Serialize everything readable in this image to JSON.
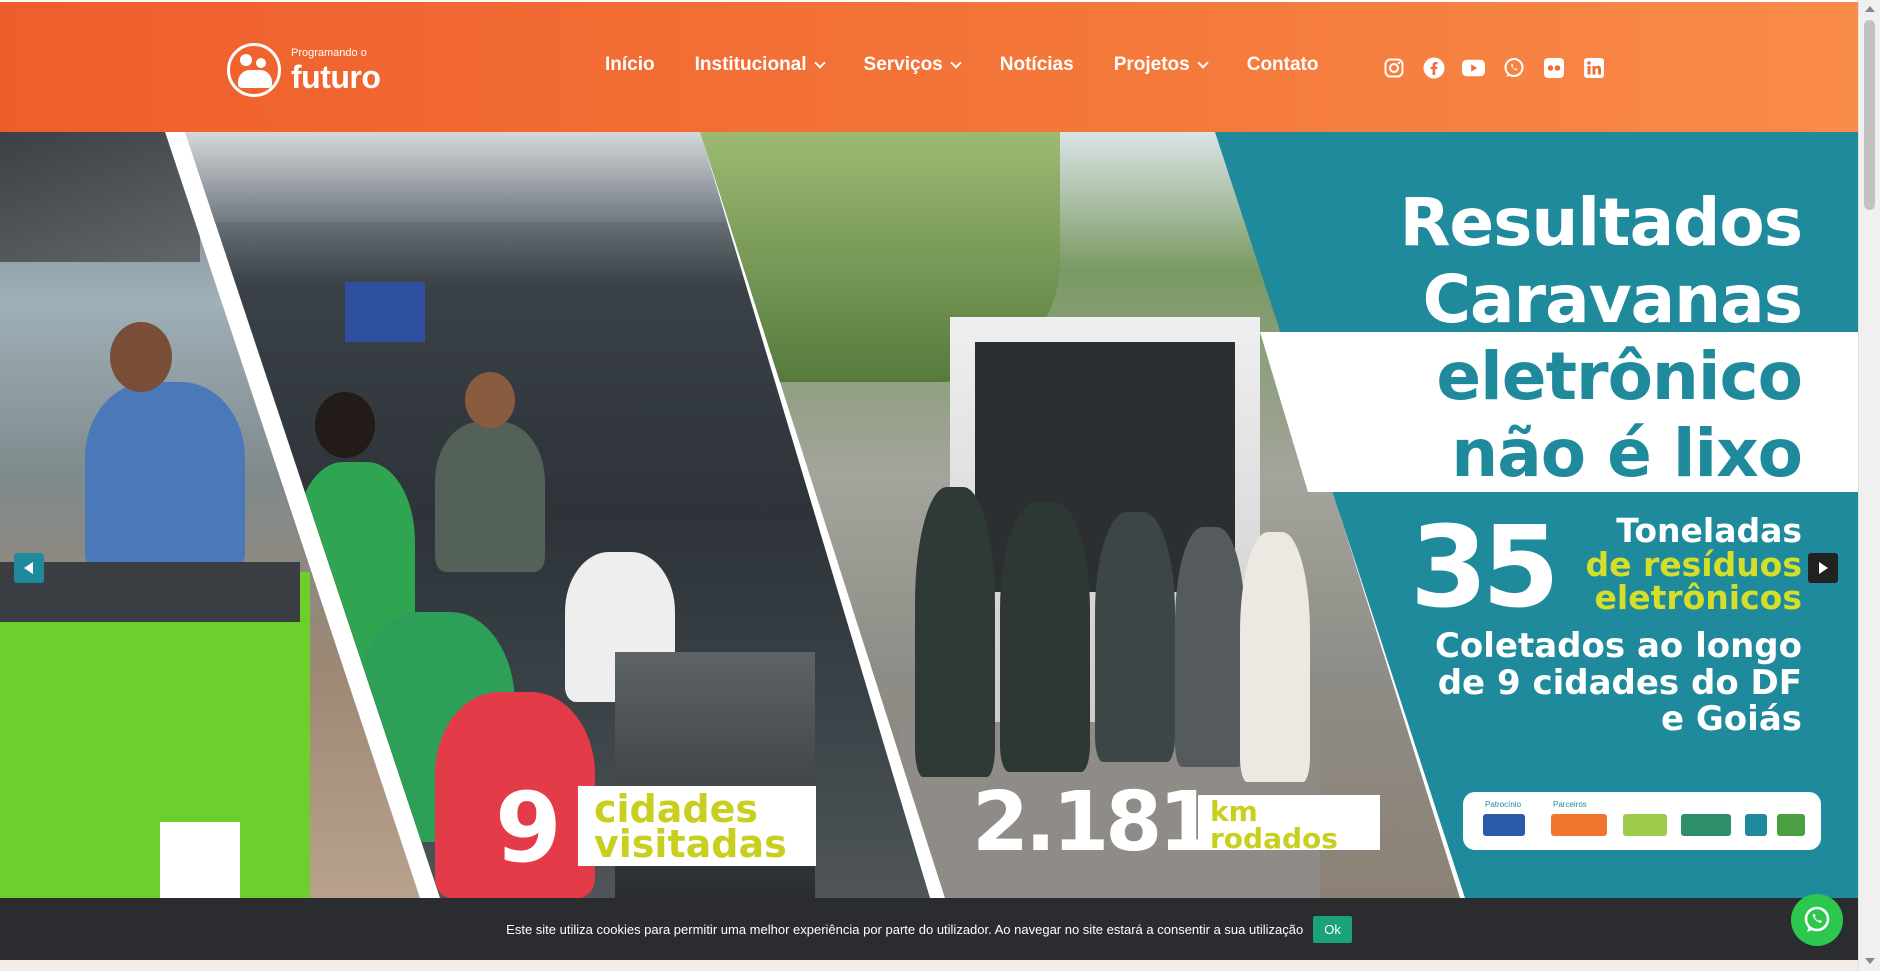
{
  "header": {
    "logo": {
      "small_text": "Programando o",
      "big_text": "futuro"
    },
    "nav": [
      {
        "label": "Início",
        "dropdown": false
      },
      {
        "label": "Institucional",
        "dropdown": true
      },
      {
        "label": "Serviços",
        "dropdown": true
      },
      {
        "label": "Notícias",
        "dropdown": false
      },
      {
        "label": "Projetos",
        "dropdown": true
      },
      {
        "label": "Contato",
        "dropdown": false
      }
    ],
    "social": [
      "instagram-icon",
      "facebook-icon",
      "youtube-icon",
      "whatsapp-icon",
      "flickr-icon",
      "linkedin-icon"
    ]
  },
  "hero": {
    "title_lines": [
      "Resultados",
      "Caravanas",
      "eletrônico",
      "não é lixo"
    ],
    "big_number": "35",
    "ton_line1": "Toneladas",
    "ton_line2": "de resíduos",
    "ton_line3": "eletrônicos",
    "coletados_lines": [
      "Coletados ao longo",
      "de 9 cidades do DF",
      "e Goiás"
    ],
    "stat_cities_number": "9",
    "stat_cities_line1": "cidades",
    "stat_cities_line2": "visitadas",
    "stat_km_number": "2.181",
    "stat_km_line1": "km",
    "stat_km_line2": "rodados",
    "sponsors": {
      "patrocinio_label": "Patrocínio",
      "parceiros_label": "Parceiros"
    },
    "colors": {
      "teal": "#1e8a9c",
      "lime": "#d5df29",
      "orange": "#ef5d2c"
    }
  },
  "cookie": {
    "text": "Este site utiliza cookies para permitir uma melhor experiência por parte do utilizador. Ao navegar no site estará a consentir a sua utilização",
    "ok_label": "Ok"
  }
}
